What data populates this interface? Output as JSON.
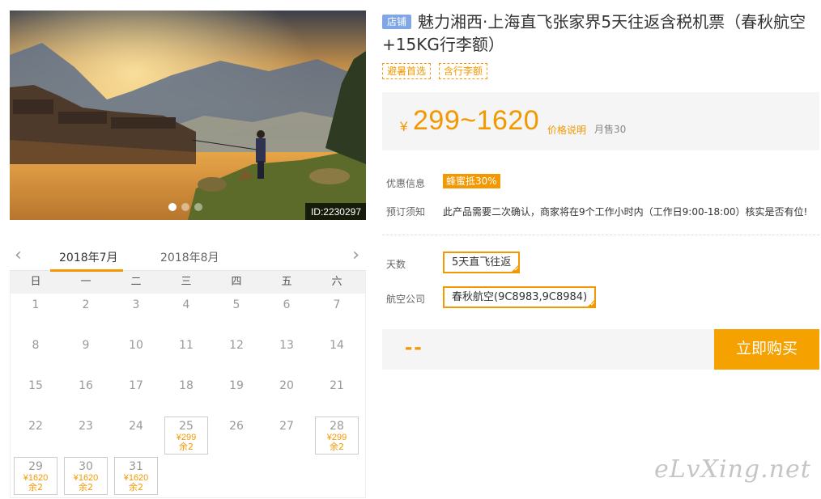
{
  "gallery": {
    "image_id": "ID:2230297",
    "dots": 3,
    "active_dot": 0
  },
  "calendar": {
    "prev_icon": "chevron-left-icon",
    "next_icon": "chevron-right-icon",
    "months": [
      "2018年7月",
      "2018年8月"
    ],
    "active_month": 0,
    "weekdays": [
      "日",
      "一",
      "二",
      "三",
      "四",
      "五",
      "六"
    ],
    "first_weekday": 0,
    "days": [
      {
        "d": "1"
      },
      {
        "d": "2"
      },
      {
        "d": "3"
      },
      {
        "d": "4"
      },
      {
        "d": "5"
      },
      {
        "d": "6"
      },
      {
        "d": "7"
      },
      {
        "d": "8"
      },
      {
        "d": "9"
      },
      {
        "d": "10"
      },
      {
        "d": "11"
      },
      {
        "d": "12"
      },
      {
        "d": "13"
      },
      {
        "d": "14"
      },
      {
        "d": "15"
      },
      {
        "d": "16"
      },
      {
        "d": "17"
      },
      {
        "d": "18"
      },
      {
        "d": "19"
      },
      {
        "d": "20"
      },
      {
        "d": "21"
      },
      {
        "d": "22"
      },
      {
        "d": "23"
      },
      {
        "d": "24"
      },
      {
        "d": "25",
        "price": "¥299",
        "stock": "余2"
      },
      {
        "d": "26"
      },
      {
        "d": "27"
      },
      {
        "d": "28",
        "price": "¥299",
        "stock": "余2"
      },
      {
        "d": "29",
        "price": "¥1620",
        "stock": "余2"
      },
      {
        "d": "30",
        "price": "¥1620",
        "stock": "余2"
      },
      {
        "d": "31",
        "price": "¥1620",
        "stock": "余2"
      }
    ]
  },
  "product": {
    "shop_badge": "店铺",
    "title": "魅力湘西·上海直飞张家界5天往返含税机票（春秋航空+15KG行李额）",
    "tags": [
      "避暑首选",
      "含行李额"
    ],
    "currency": "¥",
    "price_range": "299~1620",
    "price_explain": "价格说明",
    "monthly_sales": "月售30",
    "promo_label": "优惠信息",
    "promo_badge": "蜂蜜抵30%",
    "notice_label": "预订须知",
    "notice_text": "此产品需要二次确认，商家将在9个工作小时内（工作日9:00-18:00）核实是否有位!",
    "days_label": "天数",
    "days_option": "5天直飞往返",
    "airline_label": "航空公司",
    "airline_option": "春秋航空(9C8983,9C8984)",
    "total_price": "--",
    "buy_label": "立即购买"
  },
  "watermark": "eLvXing.net",
  "colors": {
    "accent": "#f39800",
    "buy_button": "#f5a100",
    "shop_badge": "#7fa7e6",
    "panel_bg": "#f5f5f5"
  }
}
